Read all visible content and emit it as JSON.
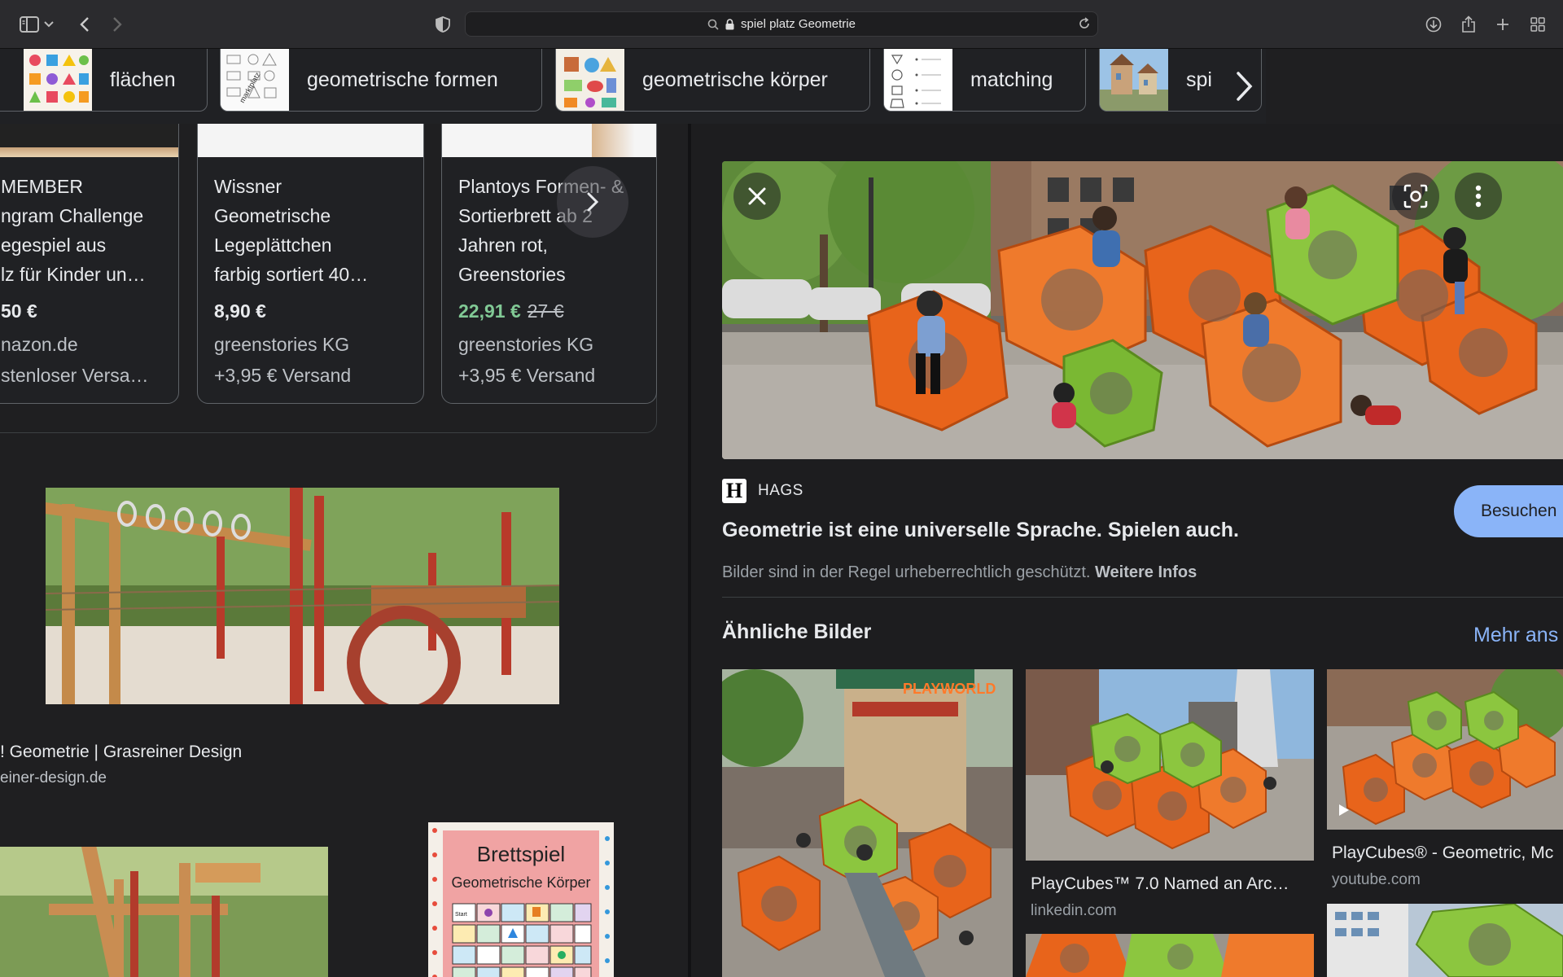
{
  "browser": {
    "address_text": "spiel platz Geometrie"
  },
  "chips": [
    {
      "label": "flächen"
    },
    {
      "label": "geometrische formen"
    },
    {
      "label": "geometrische körper"
    },
    {
      "label": "matching"
    },
    {
      "label": "spi"
    }
  ],
  "shopping": [
    {
      "title_lines": [
        "MEMBER",
        "ngram Challenge",
        "egespiel aus",
        "lz für Kinder un…"
      ],
      "price": "50 €",
      "seller": "nazon.de",
      "shipping": "stenloser Versa…"
    },
    {
      "title_lines": [
        "Wissner",
        "Geometrische",
        "Legeplättchen",
        "farbig sortiert 40…"
      ],
      "price": "8,90 €",
      "seller": "greenstories KG",
      "shipping": "+3,95 € Versand"
    },
    {
      "title_lines": [
        "Plantoys Formen- &",
        "Sortierbrett ab 2",
        "Jahren rot,",
        "Greenstories"
      ],
      "price": "22,91 €",
      "old_price": "27 €",
      "seller": "greenstories KG",
      "shipping": "+3,95 € Versand"
    }
  ],
  "results": [
    {
      "title": "! Geometrie | Grasreiner Design",
      "source": "einer-design.de"
    }
  ],
  "board_game": {
    "title": "Brettspiel",
    "subtitle": "Geometrische Körper",
    "start": "Start"
  },
  "preview": {
    "source_logo": "H",
    "source_name": "HAGS",
    "visit_label": "Besuchen",
    "title": "Geometrie ist eine universelle Sprache. Spielen auch.",
    "copyright": "Bilder sind in der Regel urheberrechtlich geschützt.",
    "copyright_link": "Weitere Infos",
    "similar_heading": "Ähnliche Bilder",
    "more_link": "Mehr ans",
    "similar": [
      {
        "caption": "",
        "source": "",
        "badge": "PLAYWORLD"
      },
      {
        "caption": "PlayCubes™ 7.0 Named an Arc…",
        "source": "linkedin.com"
      },
      {
        "caption": "PlayCubes® - Geometric, Mc",
        "source": "youtube.com"
      }
    ]
  },
  "colors": {
    "accent_blue": "#8ab4f8",
    "price_green": "#81c995",
    "orange": "#e8641b",
    "green": "#8cc63f"
  }
}
